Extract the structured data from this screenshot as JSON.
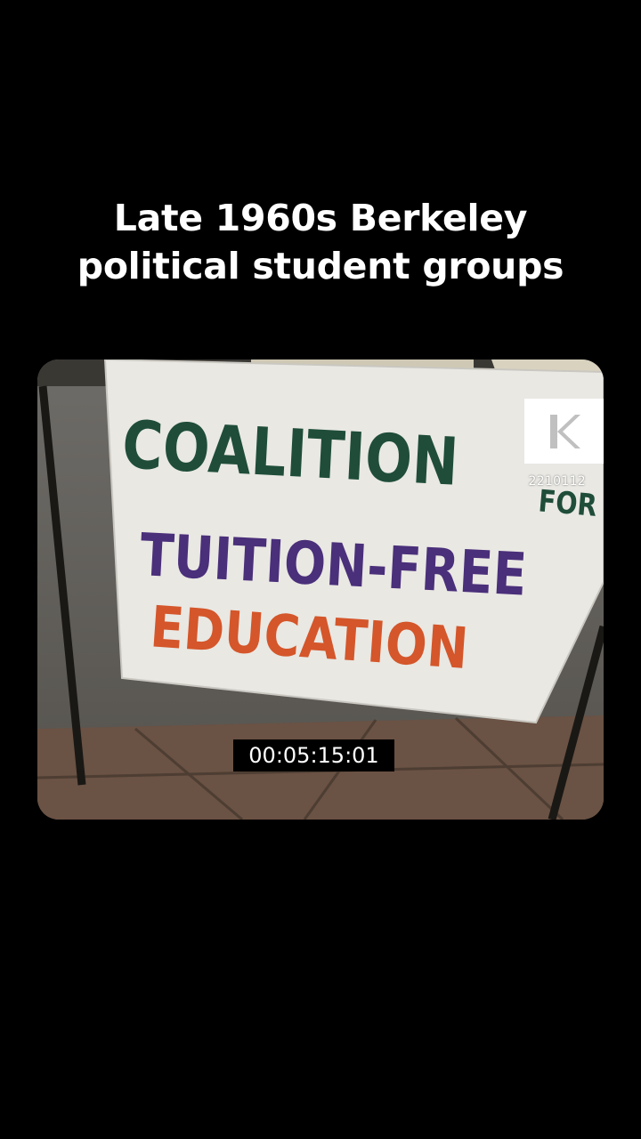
{
  "caption": {
    "line1": "Late 1960s Berkeley",
    "line2": "political student groups"
  },
  "video": {
    "sign": {
      "line1": "COALITION",
      "line2": "FOR",
      "line3": "TUITION-FREE",
      "line4": "EDUCATION"
    },
    "watermark_icon": "k-logo-icon",
    "clip_id": "2210112",
    "timecode": "00:05:15:01",
    "colors": {
      "sign_green": "#1f4d3a",
      "sign_purple": "#4a2f7a",
      "sign_orange": "#d4562a"
    }
  }
}
